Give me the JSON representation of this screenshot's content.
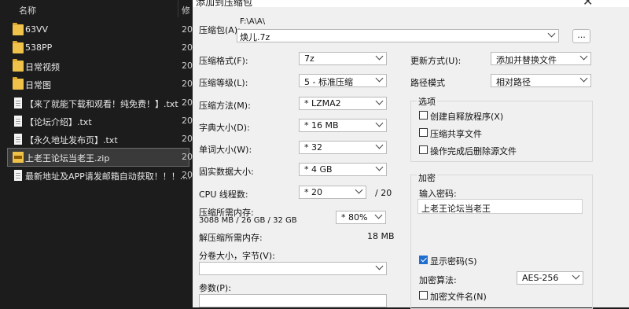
{
  "explorer": {
    "col_name": "名称",
    "col_modified": "修",
    "items": [
      {
        "label": "63VV",
        "year": "20",
        "type": "folder"
      },
      {
        "label": "538PP",
        "year": "20",
        "type": "folder"
      },
      {
        "label": "日常视频",
        "year": "20",
        "type": "folder"
      },
      {
        "label": "日常图",
        "year": "20",
        "type": "folder"
      },
      {
        "label": "【来了就能下载和观看！纯免费！】.txt",
        "year": "20",
        "type": "txt"
      },
      {
        "label": "【论坛介绍】.txt",
        "year": "20",
        "type": "txt"
      },
      {
        "label": "【永久地址发布页】.txt",
        "year": "20",
        "type": "txt"
      },
      {
        "label": "上老王论坛当老王.zip",
        "year": "20",
        "type": "zip"
      },
      {
        "label": "最新地址及APP请发邮箱自动获取！！！....",
        "year": "20",
        "type": "txt"
      }
    ]
  },
  "dialog": {
    "title": "添加到压缩包",
    "archive_label": "压缩包(A):",
    "archive_path": "F:\\A\\A\\",
    "archive_name": "焕儿.7z",
    "browse_label": "...",
    "format_label": "压缩格式(F):",
    "format_value": "7z",
    "level_label": "压缩等级(L):",
    "level_value": "5 - 标准压缩",
    "method_label": "压缩方法(M):",
    "method_value": "* LZMA2",
    "dict_label": "字典大小(D):",
    "dict_value": "* 16 MB",
    "word_label": "单词大小(W):",
    "word_value": "* 32",
    "solid_label": "固实数据大小:",
    "solid_value": "* 4 GB",
    "cpu_label": "CPU 线程数:",
    "cpu_value": "* 20",
    "cpu_max": "/ 20",
    "mem_comp_label": "压缩所需内存:",
    "mem_comp_value": "3088 MB / 26 GB / 32 GB",
    "mem_percent": "* 80%",
    "mem_decomp_label": "解压缩所需内存:",
    "mem_decomp_value": "18 MB",
    "split_label": "分卷大小，字节(V):",
    "split_value": "",
    "params_label": "参数(P):",
    "update_label": "更新方式(U):",
    "update_value": "添加并替换文件",
    "pathmode_label": "路径模式",
    "pathmode_value": "相对路径",
    "options_title": "选项",
    "opt_sfx": "创建自释放程序(X)",
    "opt_shared": "压缩共享文件",
    "opt_delete": "操作完成后删除源文件",
    "enc_title": "加密",
    "enc_pw_label": "输入密码:",
    "enc_pw_value": "上老王论坛当老王",
    "show_pw": "显示密码(S)",
    "enc_method_label": "加密算法:",
    "enc_method_value": "AES-256",
    "enc_names": "加密文件名(N)"
  }
}
